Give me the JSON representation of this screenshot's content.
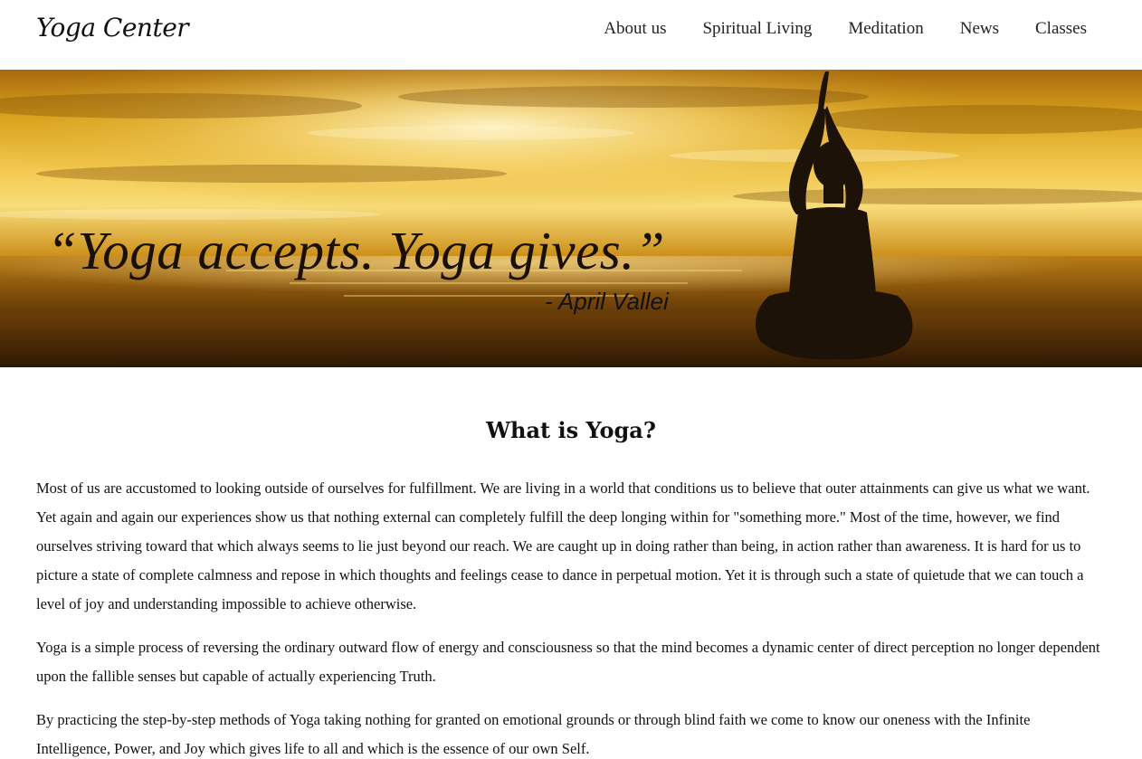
{
  "header": {
    "logo": "Yoga Center",
    "nav": [
      {
        "label": "About us"
      },
      {
        "label": "Spiritual Living"
      },
      {
        "label": "Meditation"
      },
      {
        "label": "News"
      },
      {
        "label": "Classes"
      }
    ]
  },
  "hero": {
    "quote": "“Yoga accepts. Yoga gives.”",
    "author": "- April Vallei"
  },
  "main": {
    "title": "What is Yoga?",
    "paragraphs": [
      "Most of us are accustomed to looking outside of ourselves for fulfillment. We are living in a world that conditions us to believe that outer attainments can give us what we want. Yet again and again our experiences show us that nothing external can completely fulfill the deep longing within for \"something more.\" Most of the time, however, we find ourselves striving toward that which always seems to lie just beyond our reach. We are caught up in doing rather than being, in action rather than awareness. It is hard for us to picture a state of complete calmness and repose in which thoughts and feelings cease to dance in perpetual motion. Yet it is through such a state of quietude that we can touch a level of joy and understanding impossible to achieve otherwise.",
      "Yoga is a simple process of reversing the ordinary outward flow of energy and consciousness so that the mind becomes a dynamic center of direct perception no longer dependent upon the fallible senses but capable of actually experiencing Truth.",
      "By practicing the step-by-step methods of Yoga taking nothing for granted on emotional grounds or through blind faith we come to know our oneness with the Infinite Intelligence, Power, and Joy which gives life to all and which is the essence of our own Self."
    ]
  },
  "colors": {
    "sky_light": "#f6d36a",
    "sky_mid": "#d9a21c",
    "sky_dark": "#8a5a0c",
    "sea": "#7a4a08",
    "sand": "#3a1f05",
    "silhouette": "#1c1208"
  }
}
